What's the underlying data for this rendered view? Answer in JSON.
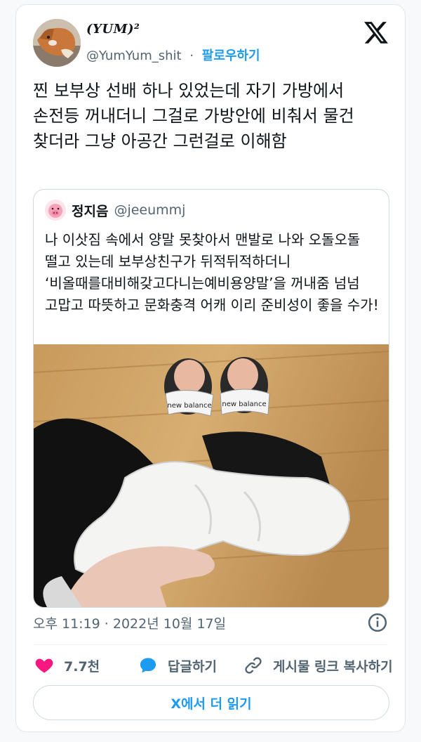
{
  "author": {
    "display_name": "(YUM)²",
    "handle": "@YumYum_shit",
    "separator": "·",
    "follow_label": "팔로우하기"
  },
  "tweet": {
    "text": "찐 보부상 선배 하나 있었는데 자기 가방에서 손전등 꺼내더니 그걸로 가방안에 비춰서 물건 찾더라 그냥 아공간 그런걸로 이해함"
  },
  "quoted_tweet": {
    "display_name": "정지음",
    "handle": "@jeeummj",
    "text": "나 이삿짐 속에서 양말 못찾아서 맨발로 나와 오돌오돌 떨고 있는데 보부상친구가 뒤적뒤적하더니 ‘비올때를대비해갖고다니는예비용양말’을 꺼내줌 넘넘 고맙고 따뜻하고 문화충격 어캐 이리 준비성이 좋을 수가!",
    "image_sandal_text": "new balance"
  },
  "timestamp": "오후 11:19 · 2022년 10월 17일",
  "actions": {
    "likes": "7.7천",
    "reply_label": "답글하기",
    "copy_link_label": "게시물 링크 복사하기"
  },
  "read_more_label": "X에서 더 읽기",
  "colors": {
    "accent": "#1d9bf0",
    "like": "#f91880",
    "text_primary": "#0f1419",
    "text_secondary": "#536471",
    "border": "#cfd9de"
  }
}
